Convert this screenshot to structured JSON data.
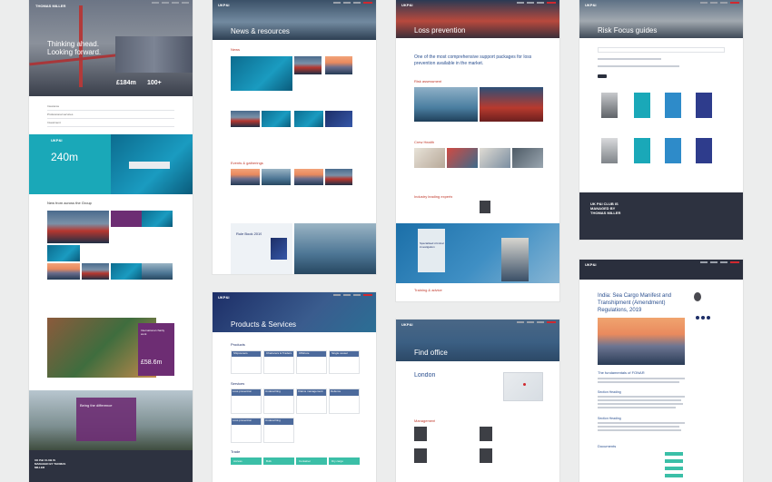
{
  "colors": {
    "navy": "#2a2f3d",
    "brand_red": "#d0282f",
    "teal": "#1aa8b8",
    "purple": "#6d2d73",
    "green": "#3bbfa7",
    "mid_blue": "#4c6a9c"
  },
  "page1": {
    "logo": "THOMAS MILLER",
    "hero_line1": "Thinking ahead.",
    "hero_line2": "Looking forward.",
    "stat1": "£184m",
    "stat2": "100+",
    "list_items": [
      "Insurance",
      "Professional services",
      "Investment"
    ],
    "ukpi_logo": "UKP&I",
    "stat_big": "240m",
    "section_news": "New from across the Group",
    "charity_title": "International charity work",
    "charity_amount": "£58.6m",
    "difference": "Being the difference",
    "footer_logo": "UK P&I CLUB IS MANAGED BY THOMAS MILLER"
  },
  "page2": {
    "logo": "UKP&I",
    "title": "News & resources",
    "section_news": "News",
    "section_events": "Events & gatherings",
    "rule_book": "Rule Book 2019"
  },
  "page3": {
    "logo": "UKP&I",
    "title": "Products & Services",
    "section_products": "Products",
    "products": [
      "Shipowners",
      "Charterers & Traders",
      "Offshore",
      "Single vessel"
    ],
    "section_services": "Services",
    "services": [
      "Loss prevention",
      "Underwriting",
      "Claims management",
      "Defence",
      "Loss prevention",
      "Underwriting"
    ],
    "section_trade": "Trade",
    "trade": [
      "Access",
      "Bulk",
      "Container",
      "Dry cargo"
    ]
  },
  "page4": {
    "logo": "UKP&I",
    "title": "Loss prevention",
    "intro": "One of the most comprehensive support packages for loss prevention available in the market.",
    "section_risk": "Risk assessment",
    "section_crew": "Crew Health",
    "section_experts": "Industry leading experts",
    "specialised": "Specialised criminal investigation",
    "section_training": "Training & advice"
  },
  "page5": {
    "logo": "UKP&I",
    "title": "Find office",
    "city": "London",
    "section_management": "Management"
  },
  "page6": {
    "logo": "UKP&I",
    "title": "Risk Focus guides",
    "footer_logo": "UK P&I CLUB IS MANAGED BY THOMAS MILLER"
  },
  "page7": {
    "logo": "UKP&I",
    "title": "India: Sea Cargo Manifest and Transhipment (Amendment) Regulations, 2019",
    "section_fundamentals": "The fundamentals of FONAR",
    "heading1": "Section Heading",
    "heading2": "Section Heading",
    "documents": "Documents"
  }
}
